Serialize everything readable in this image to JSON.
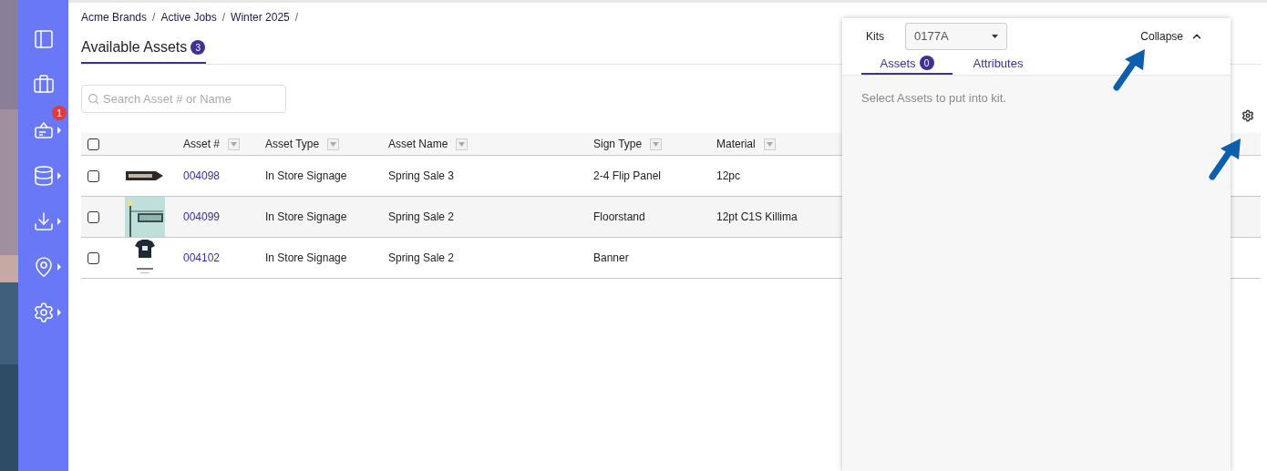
{
  "sidebar": {
    "items": [
      {
        "has_submenu": false
      },
      {
        "has_submenu": false
      },
      {
        "has_submenu": true,
        "badge": "1"
      },
      {
        "has_submenu": true
      },
      {
        "has_submenu": true
      },
      {
        "has_submenu": true
      },
      {
        "has_submenu": true
      }
    ]
  },
  "breadcrumbs": [
    "Acme Brands",
    "Active Jobs",
    "Winter 2025"
  ],
  "breadcrumb_separator": "/",
  "page_title": {
    "label": "Available Assets",
    "count": "3"
  },
  "search": {
    "placeholder": "Search Asset # or Name"
  },
  "table": {
    "columns": [
      {
        "label": "Asset #"
      },
      {
        "label": "Asset Type"
      },
      {
        "label": "Asset Name"
      },
      {
        "label": "Sign Type"
      },
      {
        "label": "Material"
      }
    ],
    "header_checked": false,
    "rows": [
      {
        "checked": false,
        "asset_no": "004098",
        "asset_type": "In Store Signage",
        "asset_name": "Spring Sale 3",
        "sign_type": "2-4 Flip Panel",
        "material": "12pc"
      },
      {
        "checked": false,
        "asset_no": "004099",
        "asset_type": "In Store Signage",
        "asset_name": "Spring Sale 2",
        "sign_type": "Floorstand",
        "material": "12pt C1S Killima"
      },
      {
        "checked": false,
        "asset_no": "004102",
        "asset_type": "In Store Signage",
        "asset_name": "Spring Sale 2",
        "sign_type": "Banner"
      }
    ]
  },
  "kit_panel": {
    "kits_label": "Kits",
    "kit_value": "0177A",
    "collapse_label": "Collapse",
    "tabs": [
      {
        "label": "Assets",
        "count": "0",
        "selected": true
      },
      {
        "label": "Attributes",
        "selected": false
      }
    ],
    "empty_message": "Select Assets to put into kit."
  }
}
